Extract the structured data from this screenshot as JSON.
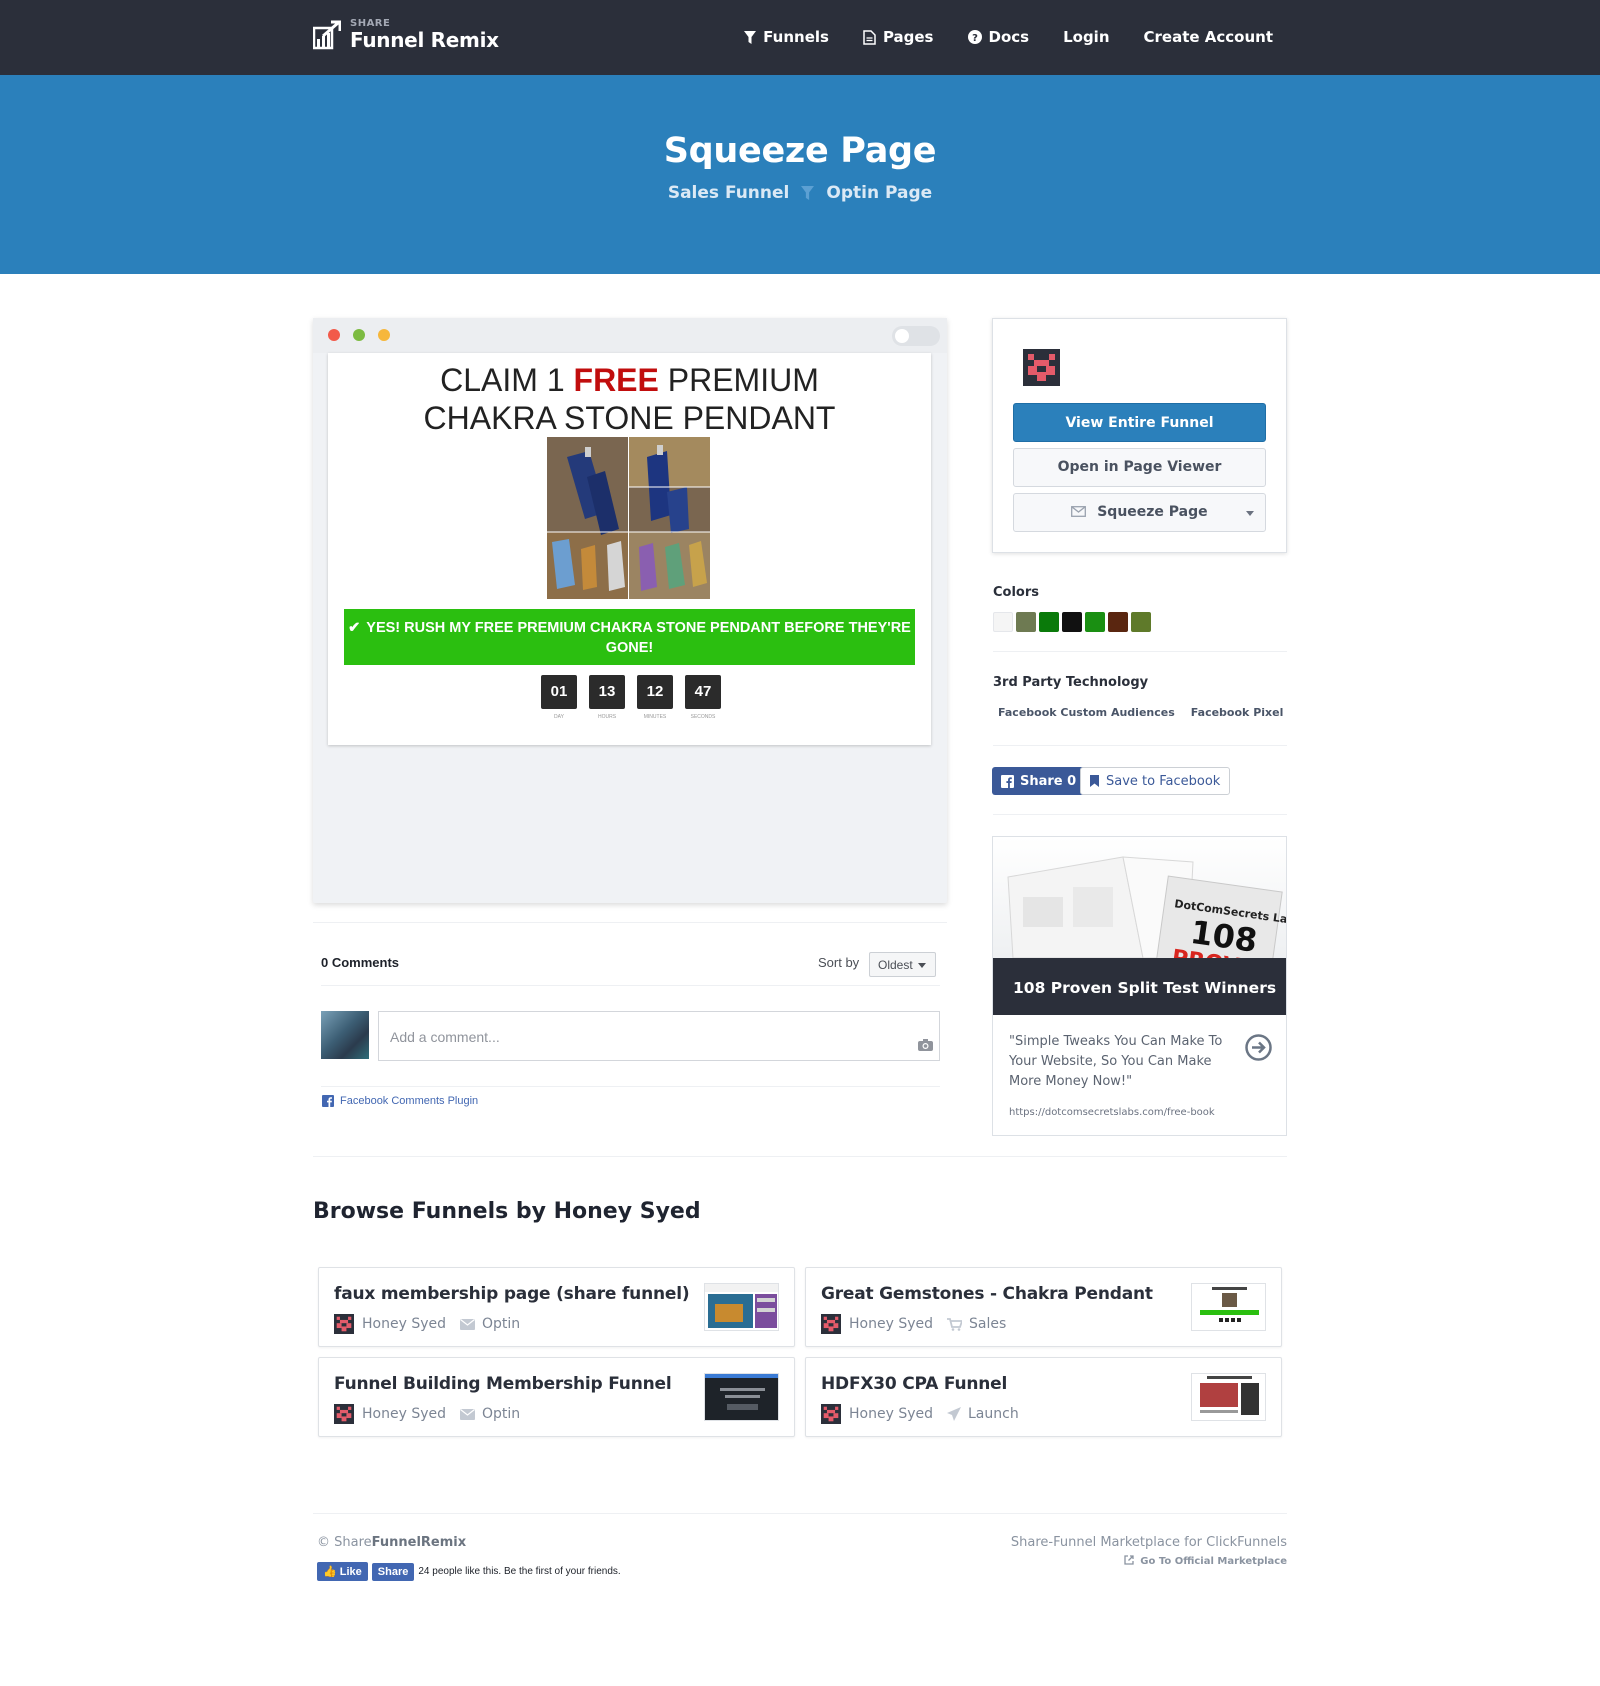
{
  "nav": {
    "logo_small": "SHARE",
    "logo_big": "Funnel Remix",
    "links": [
      "Funnels",
      "Pages",
      "Docs",
      "Login",
      "Create Account"
    ]
  },
  "hero": {
    "title": "Squeeze Page",
    "crumb_1": "Sales Funnel",
    "crumb_2": "Optin Page"
  },
  "preview": {
    "headline_pre": "CLAIM 1 ",
    "headline_free": "FREE",
    "headline_post": " PREMIUM",
    "headline_line2": "CHAKRA STONE PENDANT",
    "cta": "YES! RUSH MY FREE PREMIUM CHAKRA STONE PENDANT BEFORE THEY'RE GONE!",
    "timer": [
      {
        "value": "01",
        "label": "DAY"
      },
      {
        "value": "13",
        "label": "HOURS"
      },
      {
        "value": "12",
        "label": "MINUTES"
      },
      {
        "value": "47",
        "label": "SECONDS"
      }
    ]
  },
  "comments": {
    "count": "0 Comments",
    "sort_label": "Sort by",
    "sort_value": "Oldest",
    "placeholder": "Add a comment...",
    "plugin": "Facebook Comments Plugin"
  },
  "sidebar": {
    "view_funnel": "View Entire Funnel",
    "open_viewer": "Open in Page Viewer",
    "page_select": "Squeeze Page",
    "colors_label": "Colors",
    "colors": [
      "#f5f5f5",
      "#6e7a52",
      "#0a7a0a",
      "#111111",
      "#1a8f12",
      "#5a2610",
      "#5f7a2a"
    ],
    "tech_label": "3rd Party Technology",
    "tech": [
      "Facebook Custom Audiences",
      "Facebook Pixel"
    ],
    "share": "Share 0",
    "save": "Save to Facebook"
  },
  "ad": {
    "book_brand": "DotComSecrets Labs",
    "book_number": "108",
    "book_word": "PROV",
    "title": "108 Proven Split Test Winners",
    "quote": "\"Simple Tweaks You Can Make To Your Website, So You Can Make More Money Now!\"",
    "url": "https://dotcomsecretslabs.com/free-book"
  },
  "browse": {
    "title": "Browse Funnels by Honey Syed",
    "funnels": [
      {
        "title": "faux membership page (share funnel)",
        "author": "Honey Syed",
        "type": "Optin"
      },
      {
        "title": "Great Gemstones - Chakra Pendant",
        "author": "Honey Syed",
        "type": "Sales"
      },
      {
        "title": "Funnel Building Membership Funnel",
        "author": "Honey Syed",
        "type": "Optin"
      },
      {
        "title": "HDFX30 CPA Funnel",
        "author": "Honey Syed",
        "type": "Launch"
      }
    ]
  },
  "footer": {
    "copyright": "©",
    "brand_light": "Share",
    "brand_bold": "FunnelRemix",
    "like": "Like",
    "share": "Share",
    "like_text": "24 people like this. Be the first of your friends.",
    "marketplace": "Share-Funnel Marketplace for ClickFunnels",
    "official": "Go To Official Marketplace"
  }
}
